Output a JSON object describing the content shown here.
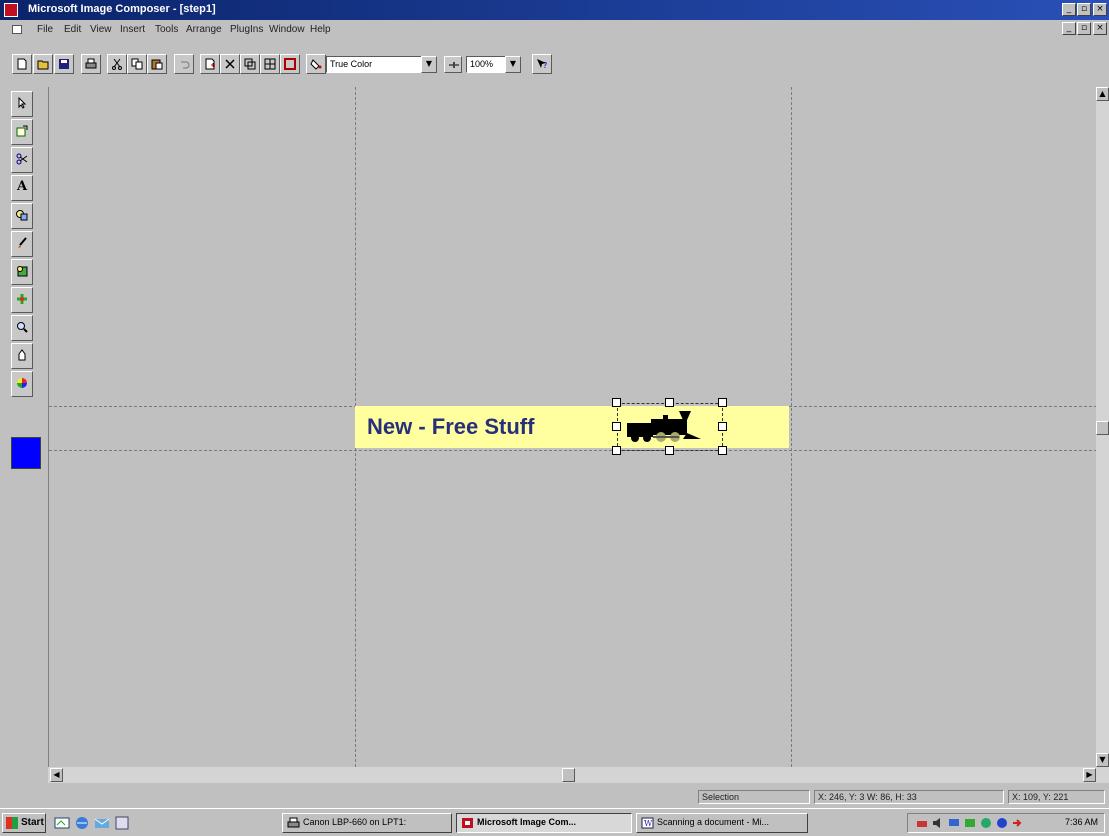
{
  "window": {
    "title": "Microsoft Image Composer - [step1]",
    "controls": [
      "_",
      "▫",
      "×"
    ],
    "doc_controls": [
      "_",
      "▫",
      "×"
    ]
  },
  "menu": {
    "items": [
      "File",
      "Edit",
      "View",
      "Insert",
      "Tools",
      "Arrange",
      "PlugIns",
      "Window",
      "Help"
    ]
  },
  "toolbar": {
    "color_format": "True Color",
    "zoom": "100%",
    "buttons": [
      "new-icon",
      "open-icon",
      "save-icon",
      "print-icon",
      "cut-icon",
      "copy-icon",
      "paste-icon",
      "undo-icon",
      "insert-icon",
      "delete-icon",
      "duplicate-icon",
      "group-icon",
      "flatten-icon",
      "color-fill-icon",
      "help-icon"
    ]
  },
  "toolbox": {
    "tools": [
      "arrow-icon",
      "arrange-icon",
      "cutout-icon",
      "text-icon",
      "shapes-icon",
      "paint-icon",
      "effects-icon",
      "texture-icon",
      "zoom-icon",
      "pan-icon",
      "color-tuning-icon"
    ],
    "text_tool_label": "A",
    "current_color": "#0000ff"
  },
  "canvas": {
    "banner_text": "New - Free Stuff",
    "banner_color": "#ffff9f",
    "text_color": "#27307a"
  },
  "status": {
    "mode": "Selection",
    "selection_info": "X: 246, Y: 3  W: 86, H: 33",
    "cursor_info": "X: 109, Y: 221"
  },
  "taskbar": {
    "start_label": "Start",
    "tasks": [
      "Canon LBP-660 on LPT1:",
      "Microsoft Image Com...",
      "Scanning a document - Mi..."
    ],
    "clock": "7:36 AM"
  }
}
